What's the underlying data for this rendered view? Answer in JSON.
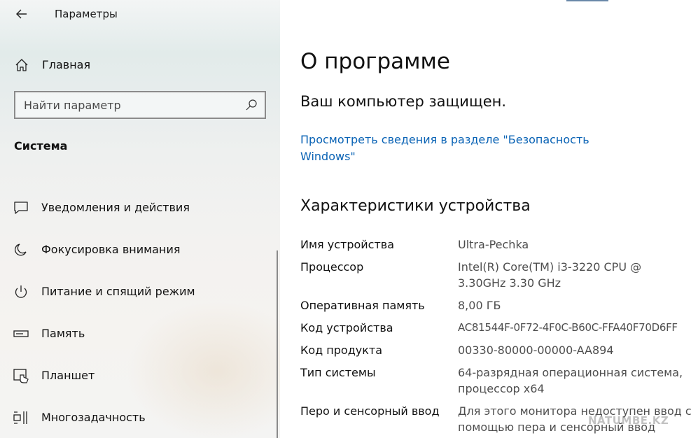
{
  "window": {
    "title": "Параметры"
  },
  "sidebar": {
    "home_label": "Главная",
    "search": {
      "placeholder": "Найти параметр",
      "value": ""
    },
    "section_title": "Система",
    "items": [
      {
        "label": "Уведомления и действия",
        "icon": "notification-icon"
      },
      {
        "label": "Фокусировка внимания",
        "icon": "moon-icon"
      },
      {
        "label": "Питание и спящий режим",
        "icon": "power-icon"
      },
      {
        "label": "Память",
        "icon": "storage-icon"
      },
      {
        "label": "Планшет",
        "icon": "tablet-icon"
      },
      {
        "label": "Многозадачность",
        "icon": "multitasking-icon"
      }
    ]
  },
  "main": {
    "page_title": "О программе",
    "protection_status": "Ваш компьютер защищен.",
    "security_link": "Просмотреть сведения в разделе \"Безопасность Windows\"",
    "specs_title": "Характеристики устройства",
    "specs": [
      {
        "key": "Имя устройства",
        "value": "Ultra-Pechka"
      },
      {
        "key": "Процессор",
        "value": "Intel(R) Core(TM) i3-3220 CPU @ 3.30GHz 3.30 GHz"
      },
      {
        "key": "Оперативная память",
        "value": "8,00 ГБ"
      },
      {
        "key": "Код устройства",
        "value": "AC81544F-0F72-4F0C-B60C-FFA40F70D6FF"
      },
      {
        "key": "Код продукта",
        "value": "00330-80000-00000-AA894"
      },
      {
        "key": "Тип системы",
        "value": "64-разрядная операционная система, процессор x64"
      },
      {
        "key": "Перо и сенсорный ввод",
        "value": "Для этого монитора недоступен ввод с помощью пера и сенсорный ввод"
      }
    ]
  },
  "watermark": "NATUMBE.KZ",
  "colors": {
    "link": "#0a63b5",
    "value_text": "#4e4e4e",
    "accent": "#6a88a8"
  }
}
